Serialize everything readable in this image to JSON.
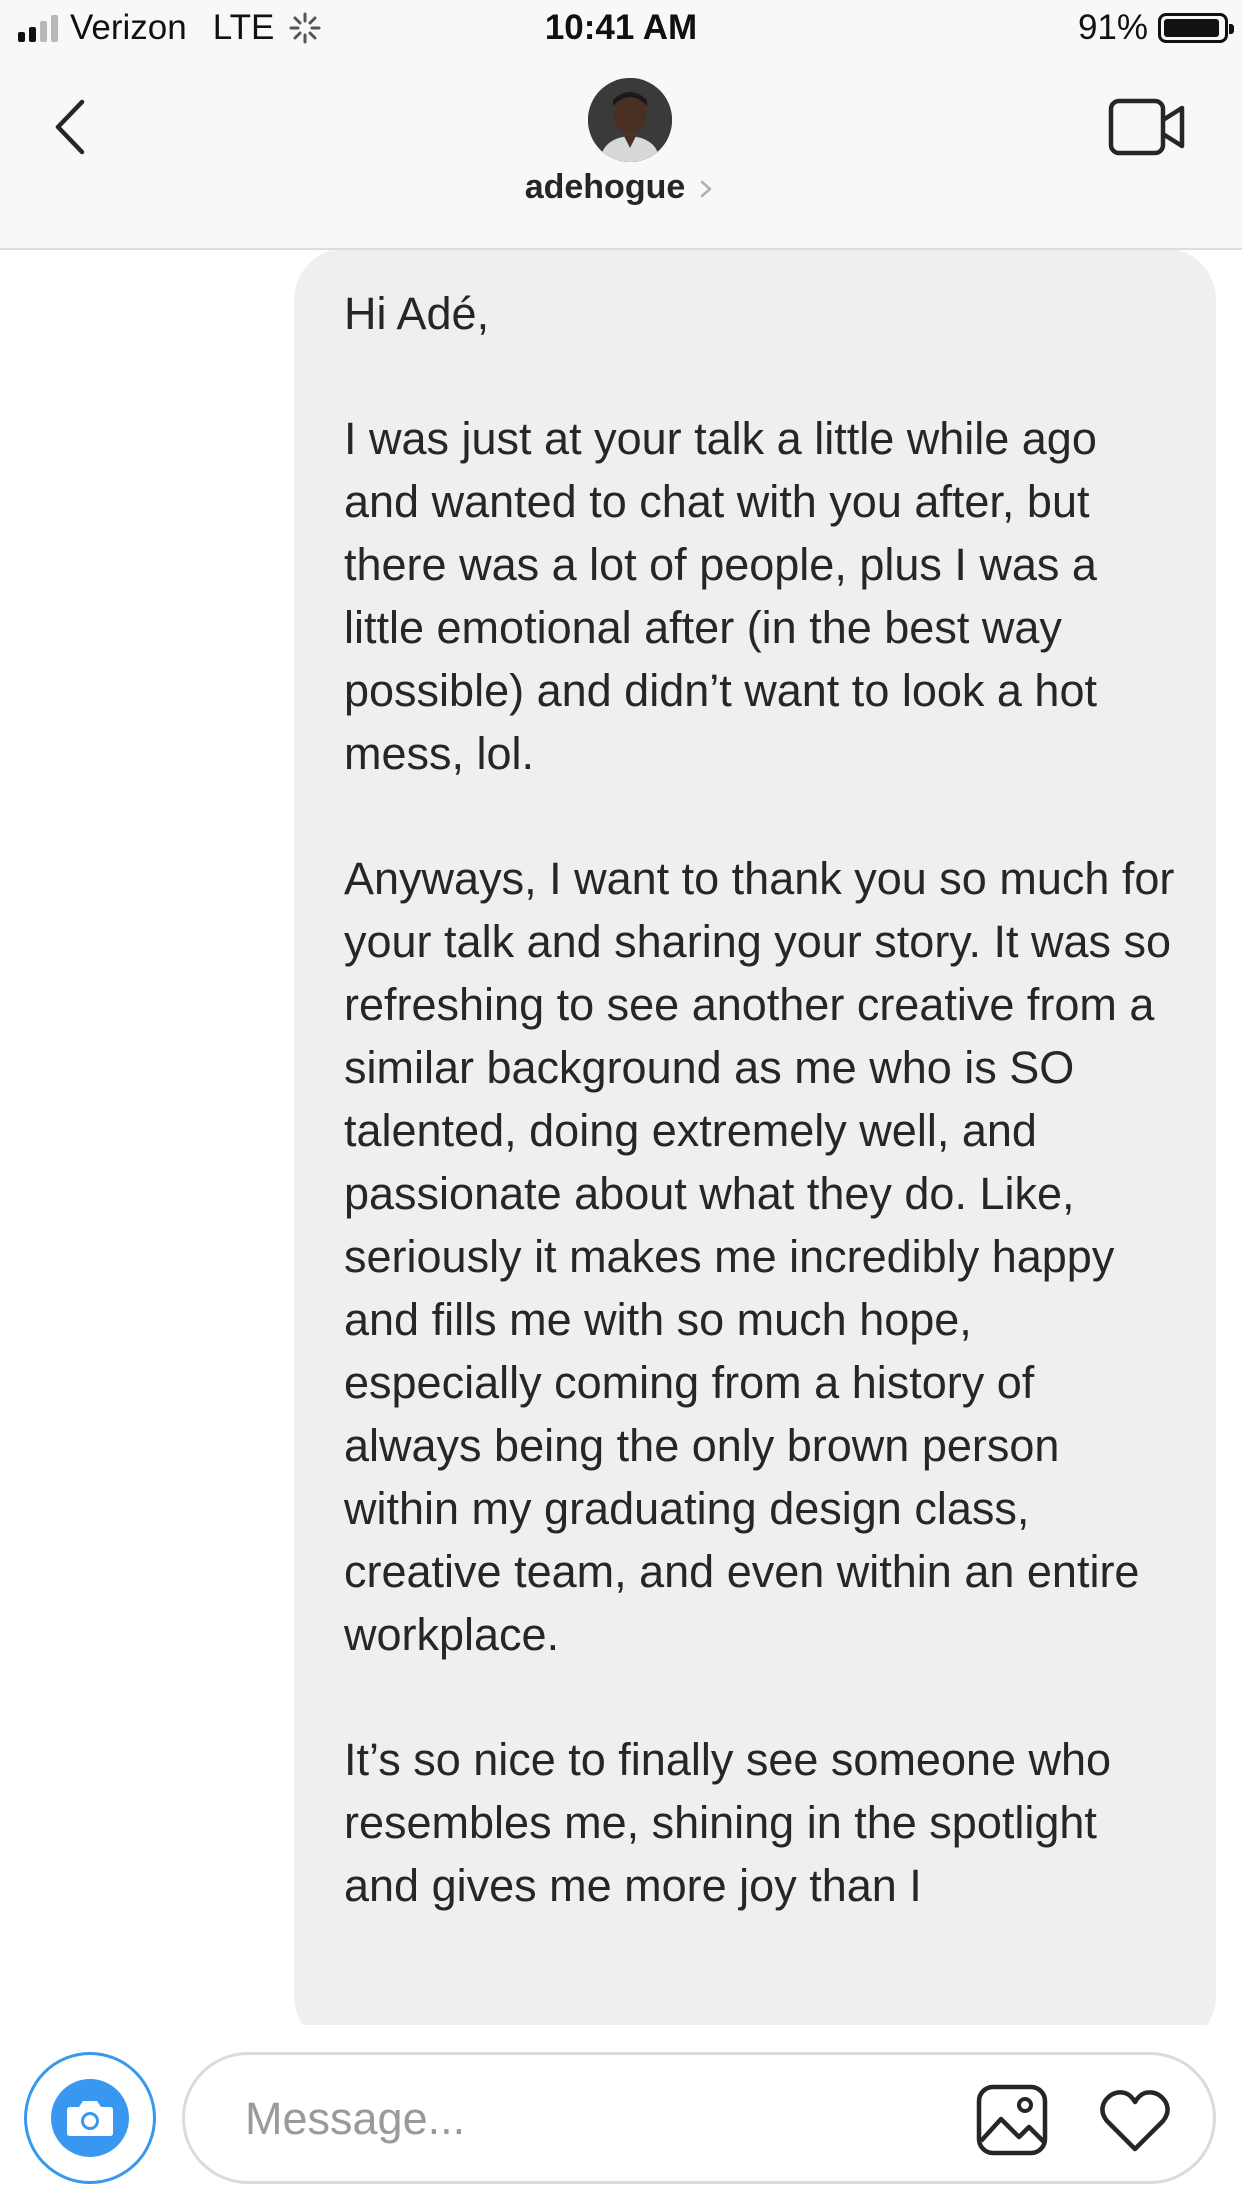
{
  "status_bar": {
    "carrier": "Verizon",
    "network": "LTE",
    "time": "10:41 AM",
    "battery_percent": "91%",
    "battery_level": 0.91
  },
  "header": {
    "username": "adehogue"
  },
  "message": {
    "paragraphs": [
      "Hi Adé,",
      "I was just at your talk a little while ago and wanted to chat with you after, but there was a lot of people, plus I was a little emotional after (in the best way possible) and didn’t want to look a hot mess, lol.",
      "Anyways, I want to thank you so much for your talk and sharing your story. It was so refreshing to see another creative from a similar background as me who is SO talented, doing extremely well, and passionate about what they do. Like, seriously it makes me incredibly happy and fills me with so much hope, especially coming from a history of always being the only brown person within my graduating design class, creative team, and even within an entire workplace.",
      "It’s so nice to finally see someone who resembles me, shining in the spotlight and gives me more joy than I"
    ]
  },
  "composer": {
    "placeholder": "Message..."
  },
  "icons": {
    "back": "chevron-left-icon",
    "video": "video-camera-icon",
    "camera": "camera-icon",
    "gallery": "image-gallery-icon",
    "heart": "heart-icon"
  },
  "colors": {
    "accent": "#3897f0",
    "bubble": "#efefef",
    "header_bg": "#f8f8f8",
    "text": "#262626"
  }
}
